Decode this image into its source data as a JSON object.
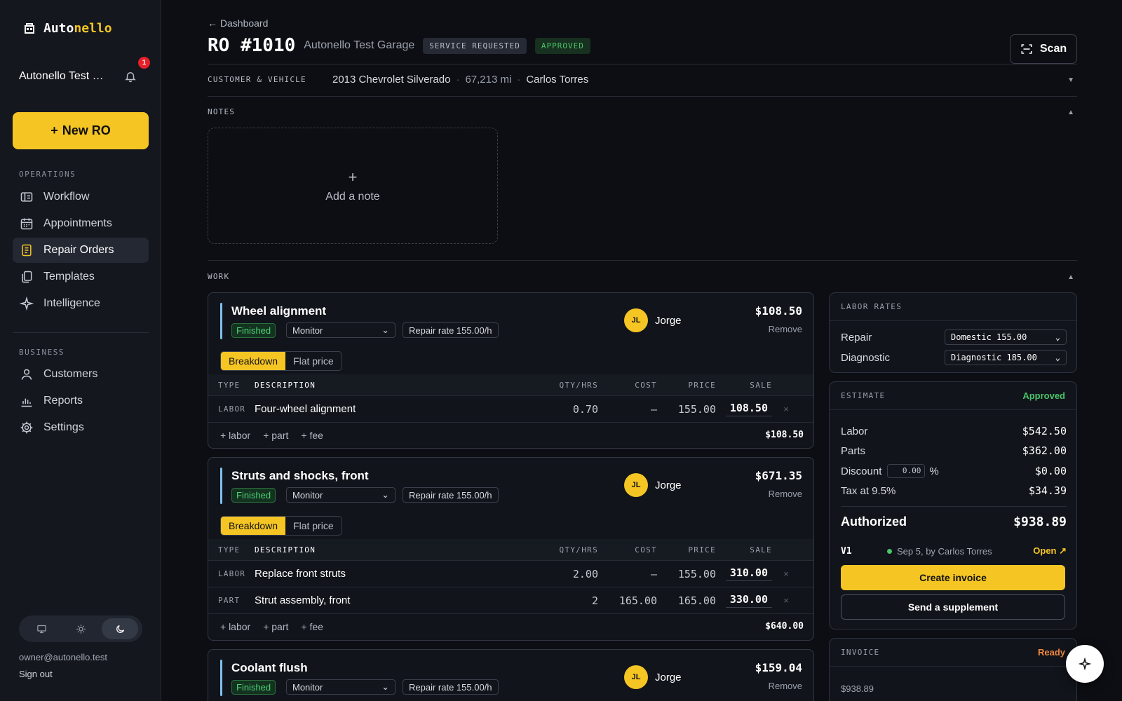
{
  "sidebar": {
    "logo_prefix": "Auto",
    "logo_suffix": "nello",
    "garage_name": "Autonello Test G...",
    "notification_count": "1",
    "new_ro_label": "New RO",
    "operations_label": "OPERATIONS",
    "operations": [
      {
        "label": "Workflow",
        "icon": "workflow-icon"
      },
      {
        "label": "Appointments",
        "icon": "calendar-icon"
      },
      {
        "label": "Repair Orders",
        "icon": "document-icon",
        "active": true
      },
      {
        "label": "Templates",
        "icon": "copy-icon"
      },
      {
        "label": "Intelligence",
        "icon": "sparkle-icon"
      }
    ],
    "business_label": "BUSINESS",
    "business": [
      {
        "label": "Customers",
        "icon": "user-icon"
      },
      {
        "label": "Reports",
        "icon": "chart-icon"
      },
      {
        "label": "Settings",
        "icon": "gear-icon"
      }
    ],
    "theme_modes": [
      "monitor-icon",
      "sun-icon",
      "moon-icon"
    ],
    "theme_selected": "moon-icon",
    "owner_email": "owner@autonello.test",
    "sign_out": "Sign out"
  },
  "header": {
    "back_label": "Dashboard",
    "ro_number": "RO #1010",
    "garage": "Autonello Test Garage",
    "status_tag": "SERVICE REQUESTED",
    "approval_tag": "APPROVED",
    "scan_label": "Scan"
  },
  "customer_vehicle": {
    "label": "CUSTOMER & VEHICLE",
    "vehicle": "2013 Chevrolet Silverado",
    "mileage": "67,213",
    "mileage_unit": "mi",
    "customer": "Carlos Torres"
  },
  "notes": {
    "label": "NOTES",
    "add_label": "Add a note"
  },
  "work": {
    "label": "WORK",
    "columns": [
      "TYPE",
      "DESCRIPTION",
      "QTY/HRS",
      "COST",
      "PRICE",
      "SALE"
    ],
    "mode_breakdown": "Breakdown",
    "mode_flat": "Flat price",
    "add_labor": "+ labor",
    "add_part": "+ part",
    "add_fee": "+ fee",
    "remove_label": "Remove",
    "jobs": [
      {
        "title": "Wheel alignment",
        "status": "Finished",
        "monitor": "Monitor",
        "rate": "Repair rate 155.00/h",
        "tech_initials": "JL",
        "tech_name": "Jorge",
        "total": "$108.50",
        "lines": [
          {
            "type": "LABOR",
            "description": "Four-wheel alignment",
            "qty": "0.70",
            "cost": "—",
            "price": "155.00",
            "sale": "108.50"
          }
        ],
        "subtotal": "$108.50"
      },
      {
        "title": "Struts and shocks, front",
        "status": "Finished",
        "monitor": "Monitor",
        "rate": "Repair rate 155.00/h",
        "tech_initials": "JL",
        "tech_name": "Jorge",
        "total": "$671.35",
        "lines": [
          {
            "type": "LABOR",
            "description": "Replace front struts",
            "qty": "2.00",
            "cost": "—",
            "price": "155.00",
            "sale": "310.00"
          },
          {
            "type": "PART",
            "description": "Strut assembly, front",
            "qty": "2",
            "cost": "165.00",
            "price": "165.00",
            "sale": "330.00"
          }
        ],
        "subtotal": "$640.00"
      },
      {
        "title": "Coolant flush",
        "status": "Finished",
        "monitor": "Monitor",
        "rate": "Repair rate 155.00/h",
        "tech_initials": "JL",
        "tech_name": "Jorge",
        "total": "$159.04"
      }
    ]
  },
  "labor_rates": {
    "title": "LABOR RATES",
    "repair_label": "Repair",
    "repair_value": "Domestic 155.00",
    "diagnostic_label": "Diagnostic",
    "diagnostic_value": "Diagnostic 185.00"
  },
  "estimate": {
    "title": "ESTIMATE",
    "status": "Approved",
    "labor_label": "Labor",
    "labor": "$542.50",
    "parts_label": "Parts",
    "parts": "$362.00",
    "discount_label": "Discount",
    "discount_input": "0.00",
    "discount_unit": "%",
    "discount": "$0.00",
    "tax_label": "Tax at 9.5%",
    "tax": "$34.39",
    "authorized_label": "Authorized",
    "authorized": "$938.89",
    "version": "V1",
    "version_info": "Sep 5, by Carlos Torres",
    "open_label": "Open ↗",
    "create_invoice": "Create invoice",
    "send_supplement": "Send a supplement"
  },
  "invoice": {
    "title": "INVOICE",
    "status": "Ready",
    "amount": "$938.89"
  },
  "colors": {
    "accent": "#f5c524",
    "background": "#0c0e13",
    "success": "#4bc46a",
    "warning": "#f0883e"
  }
}
